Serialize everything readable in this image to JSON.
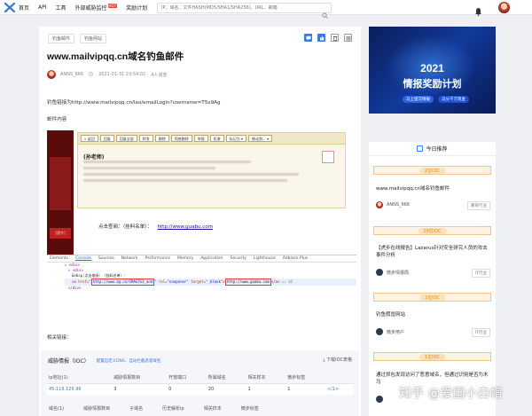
{
  "nav": {
    "items": [
      {
        "label": "首页"
      },
      {
        "label": "API"
      },
      {
        "label": "工具"
      },
      {
        "label": "外部威胁监控"
      },
      {
        "label": "奖励计划"
      }
    ],
    "hot_badge": "HOT",
    "search_placeholder": "IP、域名、文件HASH(MD5/SHA1/SHA256)、URL、邮箱"
  },
  "article": {
    "tags": [
      "钓鱼邮件",
      "钓鱼网站"
    ],
    "title": "www.mailvipqq.cn域名钓鱼邮件",
    "author": "ANNS_666",
    "date": "2021-01-31 23:54:02",
    "views": "4人浏览",
    "phish_link_line": "钓鱼链接为http://www.mailvipqq.cn/lao/emailLogin?username=T5x9Ag",
    "content_label": "邮件内容",
    "related_label": "相关链接：",
    "mail_buttons": [
      "« 返回",
      "回复",
      "回复全部",
      "转发",
      "删除",
      "彻底删除",
      "举报",
      "拒收",
      "标记为 ▾",
      "移动到... ▾"
    ],
    "mail_sender": "(孙老师)",
    "mail_sidebar_label": "[酒令]",
    "click_label": "点击查阅：（挂料名单）：",
    "click_link": "http://www.guabu.com",
    "devtools_tabs": [
      "Elements",
      "Console",
      "Sources",
      "Network",
      "Performance",
      "Memory",
      "Application",
      "Security",
      "Lighthouse",
      "Adblock Plus"
    ],
    "code_lines": [
      "▸ <div>",
      "▸ <div>",
      "  &nbsp;点击查阅：（挂料名单）：",
      "<a href=\"http://www.qq.cn/SMAG7G3_and\" rel=\"noopener\" target=\"_blank\">http://www.guabu.com</a> == $0",
      "</div>",
      "▸ <div>"
    ],
    "code_href": "http://www.qq.cn/SMAG7G3_and",
    "code_rel": "noopener",
    "code_target": "_blank",
    "code_anchor": "http://www.guabu.com",
    "code_tail": "== $0"
  },
  "ioc": {
    "title": "威胁情报（IOC）",
    "sub": "配置自定义DNS，自动拦截恶意域名",
    "download": "下载IOC表格",
    "columns": [
      "ip地址(1)",
      "威胁情报数目",
      "开放端口",
      "所属域名",
      "相关样本",
      "微步标签"
    ],
    "rows": [
      {
        "ip": "45.118.126.96",
        "count": "3",
        "ports": "0",
        "domains": "20",
        "samples": "1",
        "tags": "1"
      }
    ],
    "pager": "</1>",
    "domain_columns": [
      "域名(1)",
      "威胁情报数目",
      "子域名",
      "历史解析ip",
      "相关样本",
      "微步标签"
    ]
  },
  "banner": {
    "year": "2021",
    "title": "情报奖励计划",
    "pill1": "马上提交情报",
    "pill2": "瓜分千万现金"
  },
  "recommend": {
    "header": "今日推荐",
    "items": [
      {
        "badge": "2位IOC",
        "title": "www.mailvipqq.cn域名钓鱼邮件",
        "user": "ANNS_666",
        "category": "教育行业"
      },
      {
        "badge": "29位IOC",
        "title": "【虎步在线报告】Lazarus针对安全研究人员的攻击事件分析",
        "user": "微步情报局",
        "category": "IT行业"
      },
      {
        "badge": "1位IOC",
        "title": "钓鱼假冒网站",
        "user": "微步用户",
        "category": "IT行业"
      },
      {
        "badge": "1位IOC",
        "title": "通过抓包发现访问了恶意域名，但通过识别是否为木马",
        "user": "",
        "category": ""
      }
    ]
  },
  "watermark": "知乎 @爱国小白帽"
}
